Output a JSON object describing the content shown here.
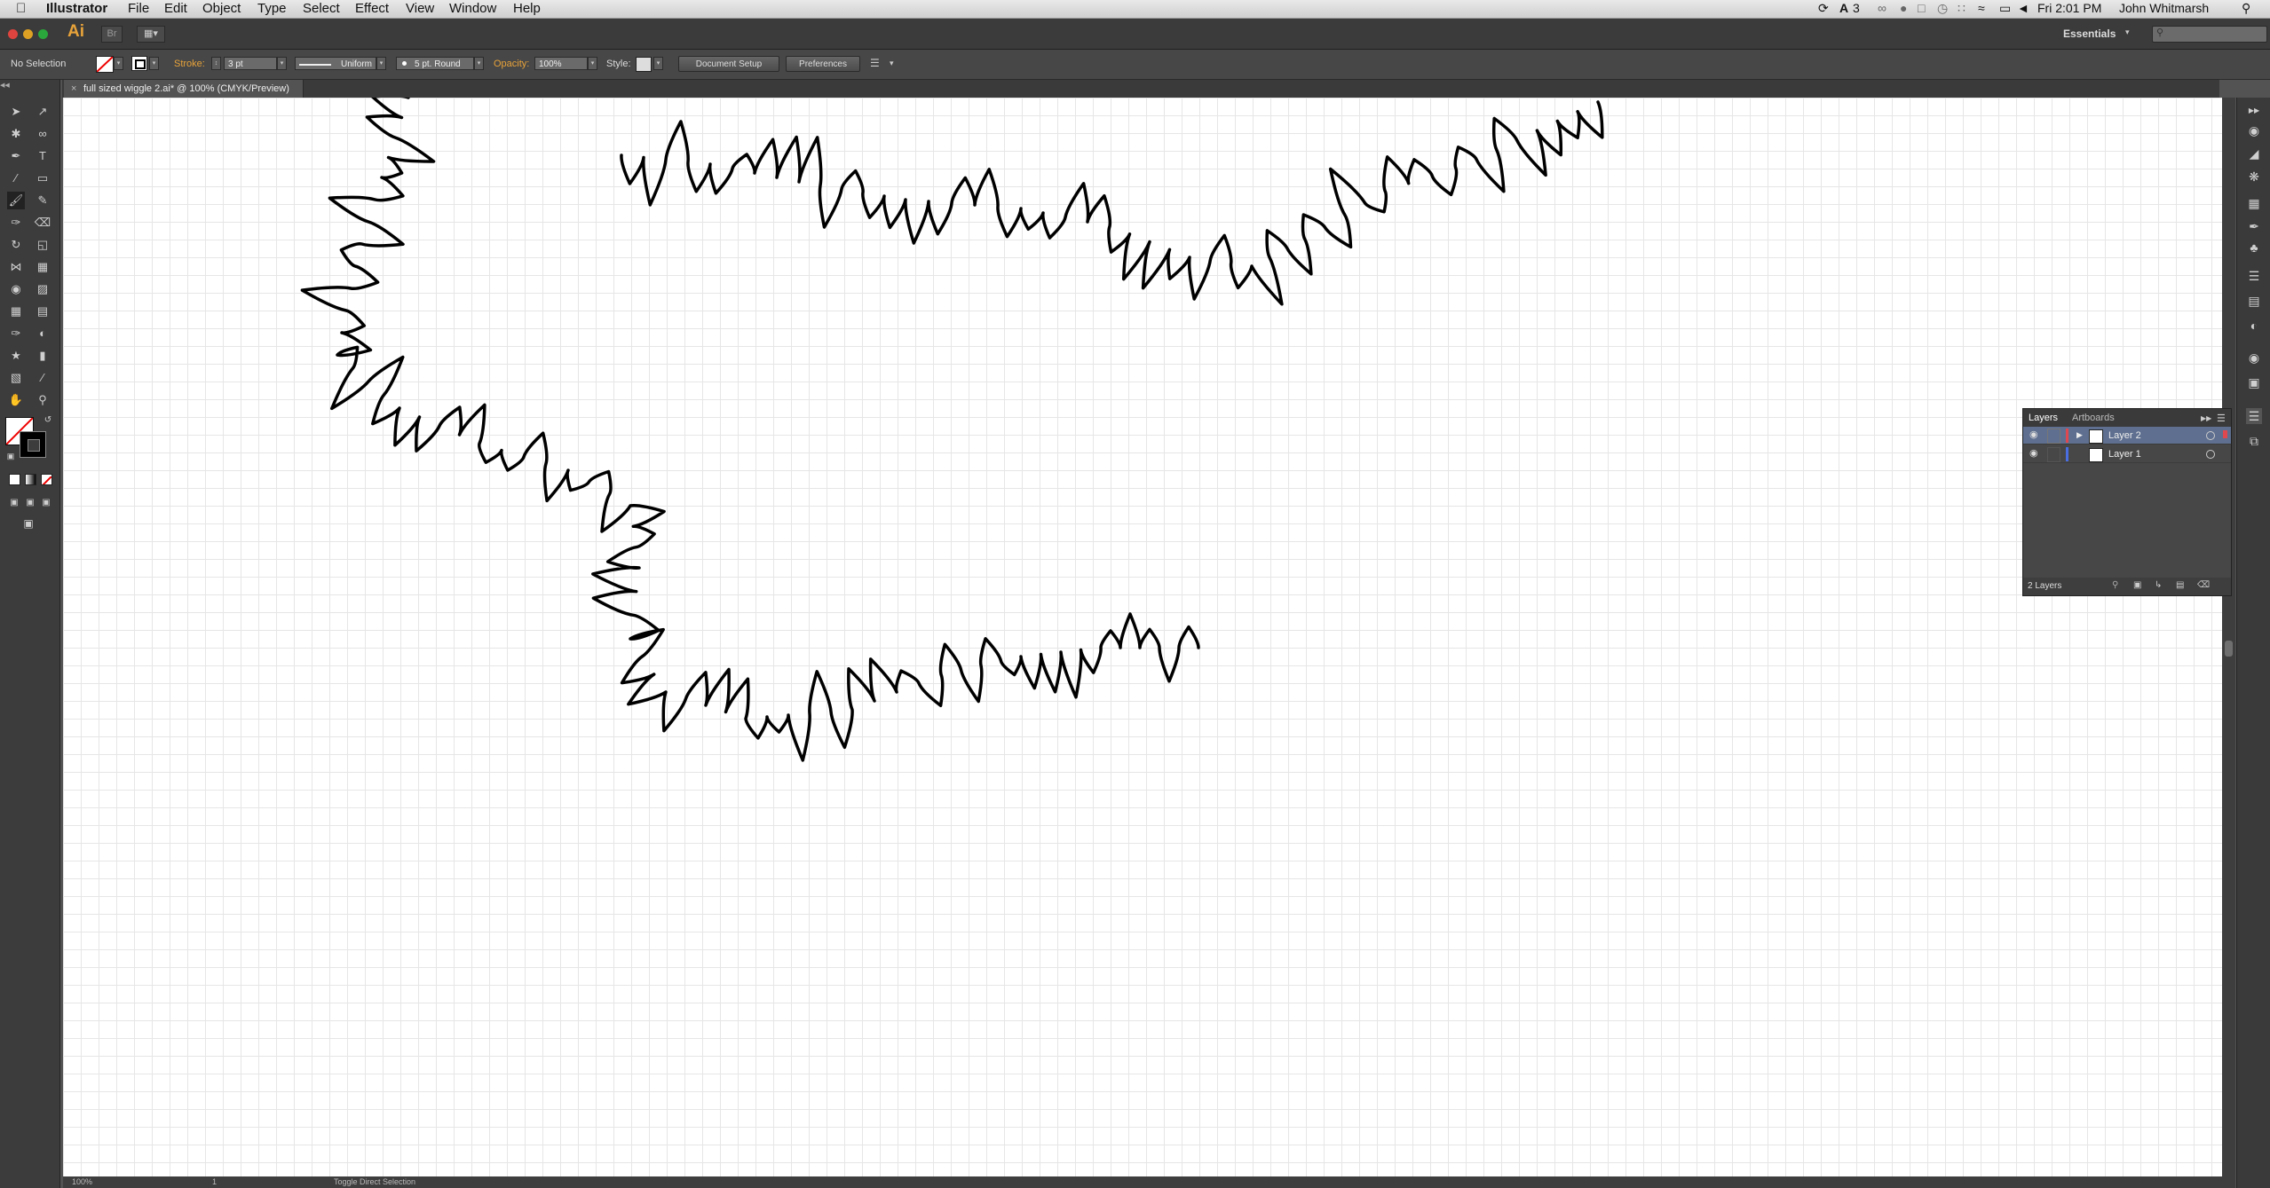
{
  "menubar": {
    "apple": "",
    "app": "Illustrator",
    "items": [
      "File",
      "Edit",
      "Object",
      "Type",
      "Select",
      "Effect",
      "View",
      "Window",
      "Help"
    ],
    "ai_count": "3",
    "clock": "Fri 2:01 PM",
    "user": "John Whitmarsh"
  },
  "appbar": {
    "logo": "Ai",
    "workspace": "Essentials",
    "search_placeholder": ""
  },
  "control": {
    "selection": "No Selection",
    "stroke_label": "Stroke:",
    "stroke_value": "3 pt",
    "profile": "Uniform",
    "brush": "5 pt. Round",
    "opacity_label": "Opacity:",
    "opacity_value": "100%",
    "style_label": "Style:",
    "doc_setup": "Document Setup",
    "preferences": "Preferences"
  },
  "doc": {
    "tab_title": "full sized wiggle 2.ai* @ 100% (CMYK/Preview)",
    "close": "×"
  },
  "status": {
    "zoom": "100%",
    "page": "1",
    "tool": "Toggle Direct Selection"
  },
  "layers_panel": {
    "tab_layers": "Layers",
    "tab_artboards": "Artboards",
    "rows": [
      {
        "name": "Layer 2",
        "color": "#e0484f",
        "selected": true
      },
      {
        "name": "Layer 1",
        "color": "#4a6de0",
        "selected": false
      }
    ],
    "count": "2 Layers"
  },
  "colors": {
    "canvas": "#ffffff",
    "grid": "#e6e6e6",
    "accent_orange": "#e8a33a",
    "stroke": "#000000"
  }
}
